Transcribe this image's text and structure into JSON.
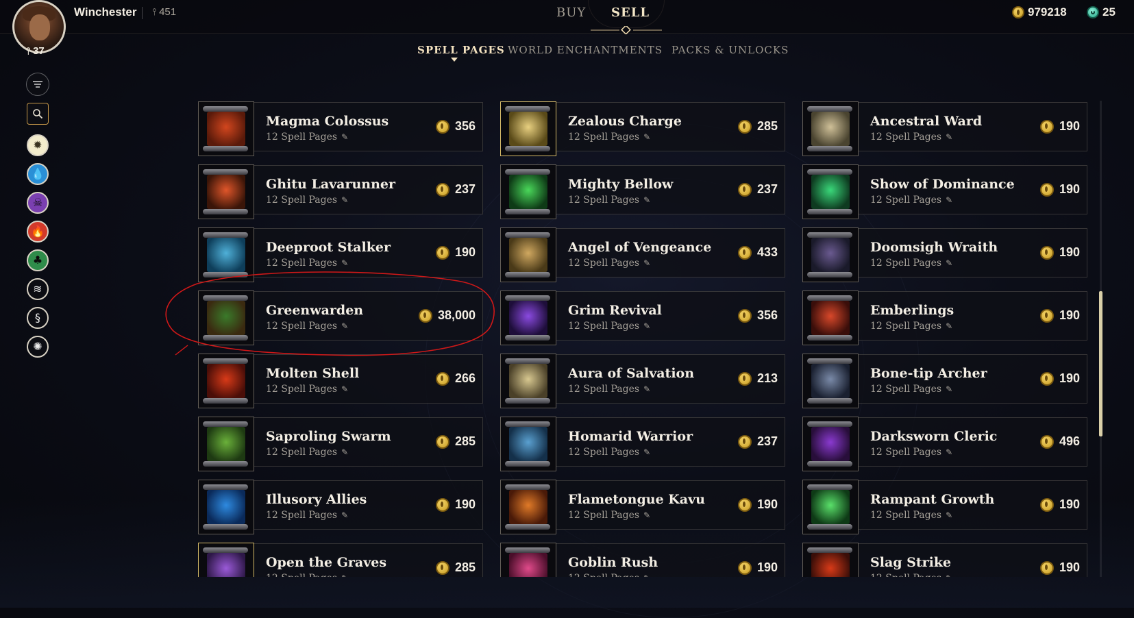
{
  "player": {
    "name": "Winchester",
    "mastery": "451",
    "level": "37"
  },
  "nav": {
    "buy_label": "BUY",
    "sell_label": "SELL"
  },
  "currency": {
    "gold": "979218",
    "gems": "25"
  },
  "subtabs": [
    "SPELL PAGES",
    "WORLD ENCHANTMENTS",
    "PACKS & UNLOCKS"
  ],
  "icons": {
    "filter": "filter-icon",
    "search": "search-icon",
    "mana": [
      "white-mana-icon",
      "blue-mana-icon",
      "black-mana-icon",
      "red-mana-icon",
      "green-mana-icon",
      "claw-icon",
      "swirl-icon",
      "burst-icon"
    ],
    "price": "gold-coin-icon",
    "mastery": "mastery-icon",
    "level": "level-icon"
  },
  "colors": {
    "accent_gold": "#d8bd6a",
    "highlight_circle": "#d01818",
    "scroll_thumb": "#d9cfa8"
  },
  "items_subtitle": "12 Spell Pages",
  "columns": [
    [
      {
        "name": "Magma Colossus",
        "price": "356"
      },
      {
        "name": "Ghitu Lavarunner",
        "price": "237"
      },
      {
        "name": "Deeproot Stalker",
        "price": "190"
      },
      {
        "name": "Greenwarden",
        "price": "38,000"
      },
      {
        "name": "Molten Shell",
        "price": "266"
      },
      {
        "name": "Saproling Swarm",
        "price": "285"
      },
      {
        "name": "Illusory Allies",
        "price": "190"
      },
      {
        "name": "Open the Graves",
        "price": "285"
      }
    ],
    [
      {
        "name": "Zealous Charge",
        "price": "285"
      },
      {
        "name": "Mighty Bellow",
        "price": "237"
      },
      {
        "name": "Angel of Vengeance",
        "price": "433"
      },
      {
        "name": "Grim Revival",
        "price": "356"
      },
      {
        "name": "Aura of Salvation",
        "price": "213"
      },
      {
        "name": "Homarid Warrior",
        "price": "237"
      },
      {
        "name": "Flametongue Kavu",
        "price": "190"
      },
      {
        "name": "Goblin Rush",
        "price": "190"
      }
    ],
    [
      {
        "name": "Ancestral Ward",
        "price": "190"
      },
      {
        "name": "Show of Dominance",
        "price": "190"
      },
      {
        "name": "Doomsigh Wraith",
        "price": "190"
      },
      {
        "name": "Emberlings",
        "price": "190"
      },
      {
        "name": "Bone-tip Archer",
        "price": "190"
      },
      {
        "name": "Darksworn Cleric",
        "price": "496"
      },
      {
        "name": "Rampant Growth",
        "price": "190"
      },
      {
        "name": "Slag Strike",
        "price": "190"
      }
    ]
  ]
}
